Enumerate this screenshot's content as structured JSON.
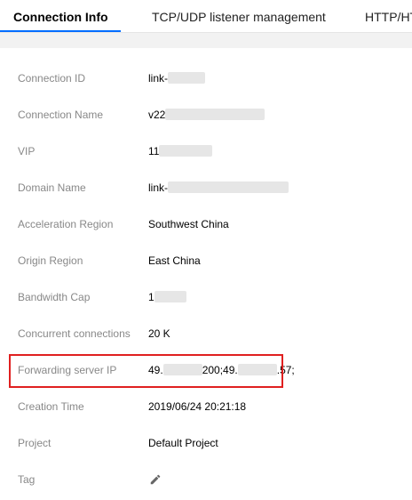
{
  "tabs": [
    {
      "label": "Connection Info",
      "active": true
    },
    {
      "label": "TCP/UDP listener management",
      "active": false
    },
    {
      "label": "HTTP/HT",
      "active": false
    }
  ],
  "fields": {
    "connection_id": {
      "label": "Connection ID",
      "value": "link-"
    },
    "connection_name": {
      "label": "Connection Name",
      "value": "v22"
    },
    "vip": {
      "label": "VIP",
      "value": "11"
    },
    "domain_name": {
      "label": "Domain Name",
      "value": "link-"
    },
    "acceleration_region": {
      "label": "Acceleration Region",
      "value": "Southwest China"
    },
    "origin_region": {
      "label": "Origin Region",
      "value": "East China"
    },
    "bandwidth_cap": {
      "label": "Bandwidth Cap",
      "value": "1"
    },
    "concurrent_connections": {
      "label": "Concurrent connections",
      "value": "20 K"
    },
    "forwarding_server_ip": {
      "label": "Forwarding server IP",
      "value_parts": [
        "49.",
        "200;49.",
        ".57;"
      ]
    },
    "creation_time": {
      "label": "Creation Time",
      "value": "2019/06/24 20:21:18"
    },
    "project": {
      "label": "Project",
      "value": "Default Project"
    },
    "tag": {
      "label": "Tag",
      "edit_icon": "pencil-icon"
    }
  },
  "colors": {
    "accent": "#006eff",
    "highlight_border": "#e02020",
    "label_text": "#888888"
  }
}
